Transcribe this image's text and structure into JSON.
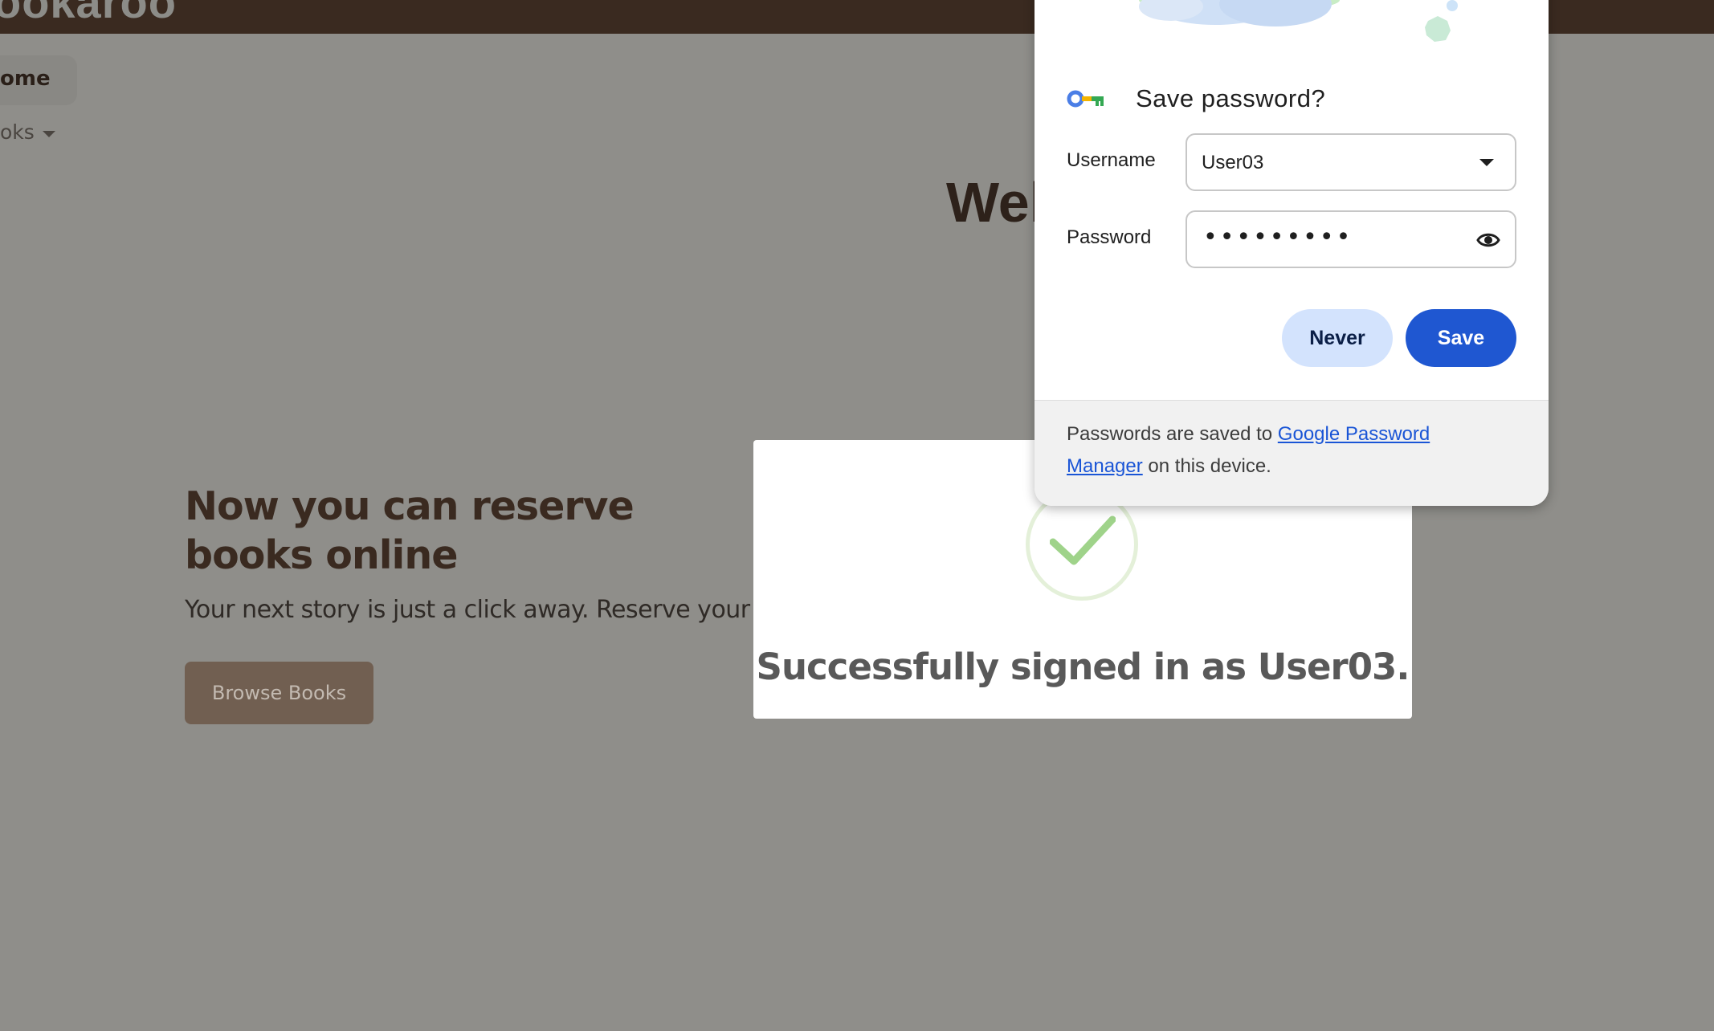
{
  "site": {
    "brand": "ookaroo",
    "nav": {
      "home_label": "ome",
      "books_label": "oks"
    },
    "welcome_heading": "Wel",
    "hero": {
      "title": "Now you can reserve books online",
      "subtitle": "Your next story is just a click away. Reserve your favo",
      "button_label": "Browse Books"
    }
  },
  "success_modal": {
    "message": "Successfully signed in as User03."
  },
  "password_prompt": {
    "title": "Save password?",
    "username_label": "Username",
    "username_value": "User03",
    "password_label": "Password",
    "password_masked": "•••••••••",
    "never_label": "Never",
    "save_label": "Save",
    "footer_prefix": "Passwords are saved to",
    "footer_link": "Google Password Manager",
    "footer_suffix": "on this device."
  },
  "colors": {
    "topbar": "#3a2a20",
    "overlay_bg": "#8f8e8a",
    "accent_blue": "#1f57d1",
    "never_bg": "#d3e3fd",
    "check_green": "#9fd38a"
  },
  "icons": [
    "key-icon",
    "chevron-down-icon",
    "eye-icon",
    "checkmark-icon"
  ]
}
